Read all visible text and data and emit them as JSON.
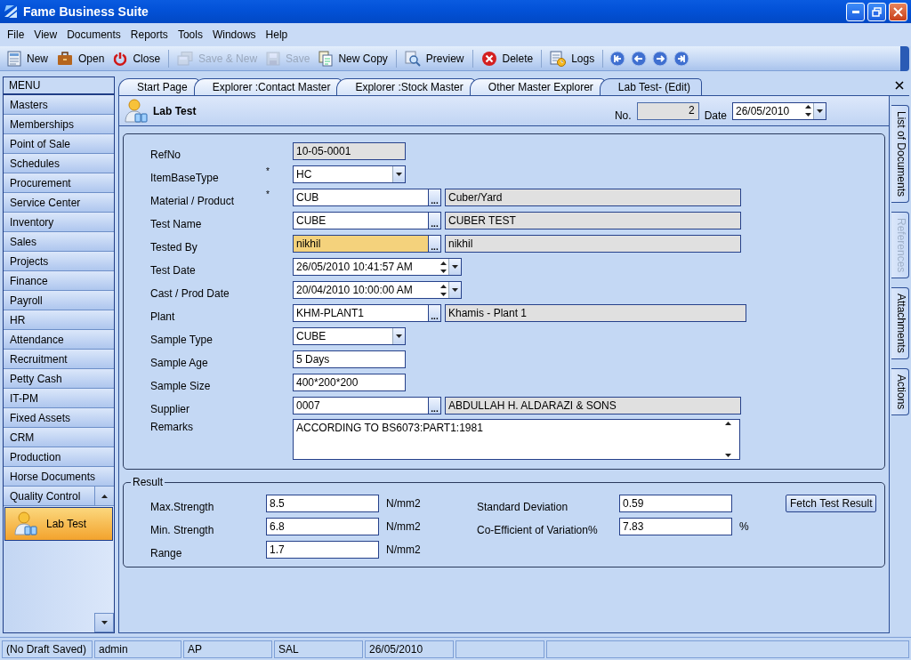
{
  "window": {
    "title": "Fame Business Suite"
  },
  "menu": [
    "File",
    "View",
    "Documents",
    "Reports",
    "Tools",
    "Windows",
    "Help"
  ],
  "toolbar": [
    {
      "kind": "button",
      "label": "New",
      "disabled": false
    },
    {
      "kind": "button",
      "label": "Open",
      "disabled": false
    },
    {
      "kind": "button",
      "label": "Close",
      "disabled": false
    },
    {
      "kind": "separator"
    },
    {
      "kind": "button",
      "label": "Save & New",
      "disabled": true
    },
    {
      "kind": "button",
      "label": "Save",
      "disabled": true
    },
    {
      "kind": "button",
      "label": "New Copy",
      "disabled": false
    },
    {
      "kind": "separator"
    },
    {
      "kind": "button",
      "label": "Preview",
      "disabled": false
    },
    {
      "kind": "separator"
    },
    {
      "kind": "button",
      "label": "Delete",
      "disabled": false
    },
    {
      "kind": "separator"
    },
    {
      "kind": "button",
      "label": "Logs",
      "disabled": false
    },
    {
      "kind": "separator"
    },
    {
      "kind": "nav"
    },
    {
      "kind": "nav"
    },
    {
      "kind": "nav"
    },
    {
      "kind": "nav"
    }
  ],
  "sidebar": {
    "header": "MENU",
    "items": [
      {
        "label": "Masters",
        "expanded": false
      },
      {
        "label": "Memberships",
        "expanded": false
      },
      {
        "label": "Point of Sale",
        "expanded": false
      },
      {
        "label": "Schedules",
        "expanded": false
      },
      {
        "label": "Procurement",
        "expanded": false
      },
      {
        "label": "Service Center",
        "expanded": false
      },
      {
        "label": "Inventory",
        "expanded": false
      },
      {
        "label": "Sales",
        "expanded": false
      },
      {
        "label": "Projects",
        "expanded": false
      },
      {
        "label": "Finance",
        "expanded": false
      },
      {
        "label": "Payroll",
        "expanded": false
      },
      {
        "label": "HR",
        "expanded": false
      },
      {
        "label": "Attendance",
        "expanded": false
      },
      {
        "label": "Recruitment",
        "expanded": false
      },
      {
        "label": "Petty Cash",
        "expanded": false
      },
      {
        "label": "IT-PM",
        "expanded": false
      },
      {
        "label": "Fixed Assets",
        "expanded": false
      },
      {
        "label": "CRM",
        "expanded": false
      },
      {
        "label": "Production",
        "expanded": false
      },
      {
        "label": "Horse Documents",
        "expanded": false
      },
      {
        "label": "Quality Control",
        "expanded": true,
        "children": [
          {
            "label": "Lab Test",
            "selected": true
          }
        ]
      }
    ]
  },
  "tabs": [
    {
      "label": "Start Page",
      "selected": false
    },
    {
      "label": "Explorer :Contact Master",
      "selected": false
    },
    {
      "label": "Explorer :Stock Master",
      "selected": false
    },
    {
      "label": "Other Master Explorer",
      "selected": false
    },
    {
      "label": "Lab Test- (Edit)",
      "selected": true
    }
  ],
  "document": {
    "title": "Lab Test",
    "no_label": "No.",
    "no": "2",
    "date_label": "Date",
    "date": "26/05/2010"
  },
  "form": [
    {
      "kind": "text",
      "label": "RefNo",
      "value": "10-05-0001",
      "readonly": true,
      "focused": false
    },
    {
      "kind": "combo",
      "label": "ItemBaseType",
      "required_mark": "*",
      "value": "HC",
      "focused": false
    },
    {
      "kind": "lookup",
      "label": "Material / Product",
      "required_mark": "*",
      "value": "CUB",
      "browse": "...",
      "description": "Cuber/Yard",
      "focused": false
    },
    {
      "kind": "lookup",
      "label": "Test Name",
      "value": "CUBE",
      "browse": "...",
      "description": "CUBER TEST",
      "focused": false
    },
    {
      "kind": "lookup",
      "label": "Tested By",
      "value": "nikhil",
      "browse": "...",
      "description": "nikhil",
      "focused": true
    },
    {
      "kind": "datetime",
      "label": "Test Date",
      "value": "26/05/2010 10:41:57 AM",
      "focused": false
    },
    {
      "kind": "datetime",
      "label": "Cast / Prod Date",
      "value": "20/04/2010 10:00:00 AM",
      "focused": false
    },
    {
      "kind": "lookup",
      "label": "Plant",
      "value": "KHM-PLANT1",
      "browse": "...",
      "description": "Khamis - Plant 1",
      "focused": false
    },
    {
      "kind": "combo",
      "label": "Sample Type",
      "value": "CUBE",
      "focused": false
    },
    {
      "kind": "text",
      "label": "Sample Age",
      "value": "5 Days",
      "readonly": false,
      "focused": false
    },
    {
      "kind": "text",
      "label": "Sample Size",
      "value": "400*200*200",
      "readonly": false,
      "focused": false
    },
    {
      "kind": "lookup",
      "label": "Supplier",
      "value": "0007",
      "browse": "...",
      "description": "ABDULLAH H. ALDARAZI & SONS",
      "focused": false
    },
    {
      "kind": "memo",
      "label": "Remarks",
      "value": "ACCORDING TO BS6073:PART1:1981",
      "focused": false
    }
  ],
  "result": {
    "title": "Result",
    "left": [
      {
        "label": "Max.Strength",
        "value": "8.5",
        "unit": "N/mm2"
      },
      {
        "label": "Min. Strength",
        "value": "6.8",
        "unit": "N/mm2"
      },
      {
        "label": "Range",
        "value": "1.7",
        "unit": "N/mm2"
      }
    ],
    "right": [
      {
        "label": "Standard Deviation",
        "value": "0.59"
      },
      {
        "label": "Co-Efficient of Variation%",
        "value": "7.83",
        "unit": "%"
      }
    ],
    "button": "Fetch Test Result"
  },
  "side_tabs": [
    {
      "label": "List of Documents",
      "disabled": false
    },
    {
      "label": "References",
      "disabled": true
    },
    {
      "label": "Attachments",
      "disabled": false
    },
    {
      "label": "Actions",
      "disabled": false
    }
  ],
  "status_bar": [
    "(No Draft Saved)",
    "admin",
    "AP",
    "SAL",
    "26/05/2010"
  ]
}
